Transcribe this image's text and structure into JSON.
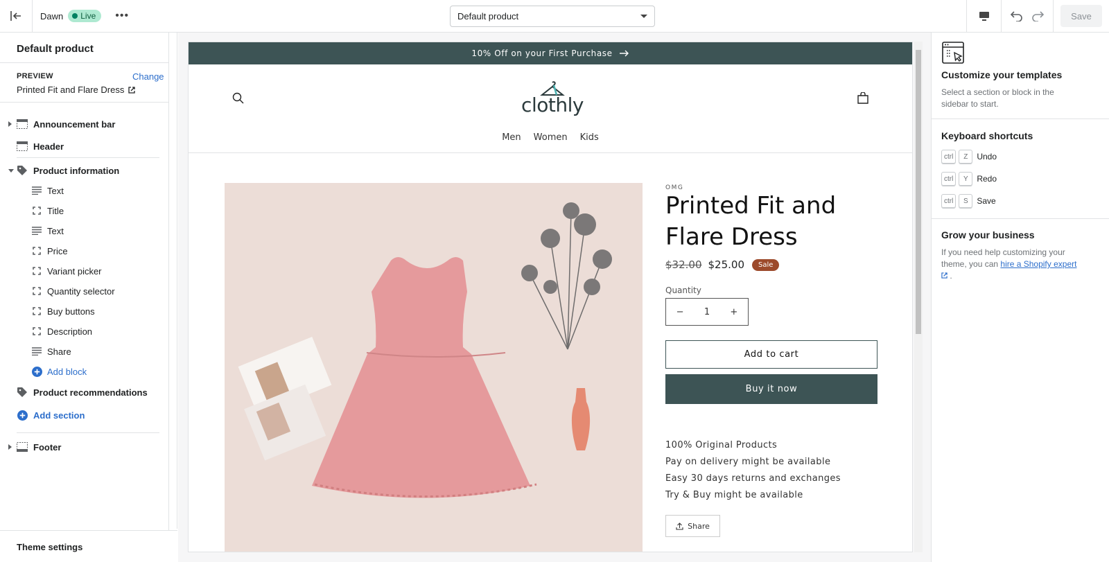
{
  "topbar": {
    "theme_name": "Dawn",
    "status_badge": "Live",
    "more_label": "•••",
    "template_select": "Default product",
    "save_label": "Save"
  },
  "sidebar": {
    "title": "Default product",
    "preview_label": "PREVIEW",
    "change_label": "Change",
    "preview_value": "Printed Fit and Flare Dress",
    "sections": [
      {
        "label": "Announcement bar"
      },
      {
        "label": "Header"
      },
      {
        "label": "Product information"
      }
    ],
    "blocks": [
      {
        "label": "Text",
        "icon": "text-lines-icon"
      },
      {
        "label": "Title",
        "icon": "block-frame-icon"
      },
      {
        "label": "Text",
        "icon": "text-lines-icon"
      },
      {
        "label": "Price",
        "icon": "block-frame-icon"
      },
      {
        "label": "Variant picker",
        "icon": "block-frame-icon"
      },
      {
        "label": "Quantity selector",
        "icon": "block-frame-icon"
      },
      {
        "label": "Buy buttons",
        "icon": "block-frame-icon"
      },
      {
        "label": "Description",
        "icon": "block-frame-icon"
      },
      {
        "label": "Share",
        "icon": "text-lines-icon"
      }
    ],
    "add_block": "Add block",
    "product_recommendations": "Product recommendations",
    "add_section": "Add section",
    "footer": "Footer",
    "theme_settings": "Theme settings"
  },
  "preview": {
    "announcement": "10% Off on your First Purchase",
    "logo_text": "clothly",
    "nav": [
      "Men",
      "Women",
      "Kids"
    ],
    "vendor": "OMG",
    "product_title": "Printed Fit and Flare Dress",
    "compare_price": "$32.00",
    "price": "$25.00",
    "sale_badge": "Sale",
    "quantity_label": "Quantity",
    "quantity_value": "1",
    "minus": "−",
    "plus": "+",
    "add_to_cart": "Add to cart",
    "buy_now": "Buy it now",
    "features": [
      "100% Original Products",
      "Pay on delivery might be available",
      "Easy 30 days returns and exchanges",
      "Try & Buy might be available"
    ],
    "share": "Share"
  },
  "right_panel": {
    "customize_title": "Customize your templates",
    "customize_text": "Select a section or block in the sidebar to start.",
    "shortcuts_title": "Keyboard shortcuts",
    "shortcuts": [
      {
        "mod": "ctrl",
        "key": "Z",
        "action": "Undo"
      },
      {
        "mod": "ctrl",
        "key": "Y",
        "action": "Redo"
      },
      {
        "mod": "ctrl",
        "key": "S",
        "action": "Save"
      }
    ],
    "grow_title": "Grow your business",
    "grow_text_before": "If you need help customizing your theme, you can ",
    "grow_link": "hire a Shopify expert",
    "grow_text_after": " ."
  },
  "colors": {
    "accent": "#2c6ecb",
    "live_badge": "#aee9d1",
    "store_primary": "#3d5455",
    "sale_badge": "#9c4a2b"
  }
}
